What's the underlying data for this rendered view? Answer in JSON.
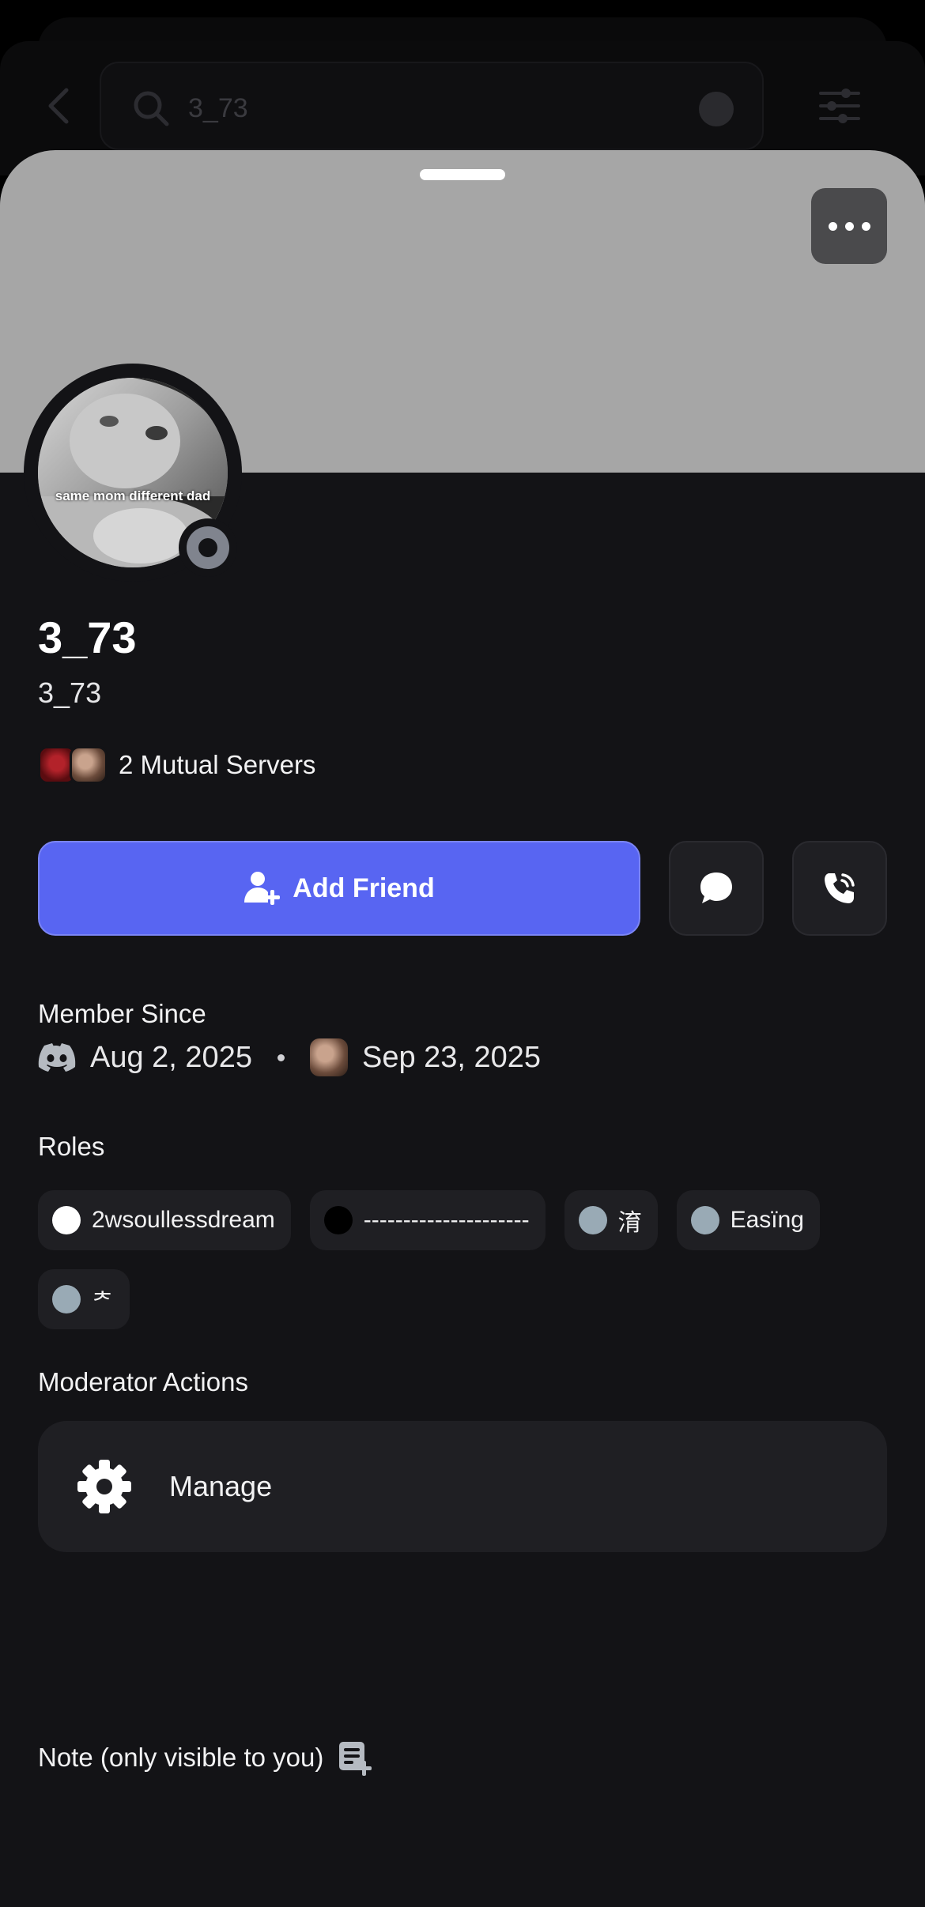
{
  "background": {
    "search_query": "3_73"
  },
  "profile": {
    "display_name": "3_73",
    "username": "3_73",
    "avatar_caption": "same mom different dad",
    "mutual_servers_label": "2 Mutual Servers",
    "status": "offline"
  },
  "actions": {
    "add_friend_label": "Add Friend",
    "message_icon": "chat-bubble-icon",
    "call_icon": "phone-call-icon",
    "more_icon": "ellipsis-icon"
  },
  "member_since": {
    "title": "Member Since",
    "discord_date": "Aug 2, 2025",
    "server_date": "Sep 23, 2025"
  },
  "roles": {
    "title": "Roles",
    "items": [
      {
        "name": "2wsoullessdream",
        "color": "#ffffff"
      },
      {
        "name": "---------------------",
        "color": "#000000"
      },
      {
        "name": "淯",
        "color": "#99aab5"
      },
      {
        "name": "Easïng",
        "color": "#99aab5"
      },
      {
        "name": "ᅔ",
        "color": "#99aab5"
      }
    ]
  },
  "moderator": {
    "title": "Moderator Actions",
    "manage_label": "Manage"
  },
  "note": {
    "label": "Note (only visible to you)"
  },
  "colors": {
    "accent": "#5865f2",
    "banner": "#a6a6a6",
    "sheet_bg": "#131316",
    "card_bg": "#1f1f23"
  }
}
